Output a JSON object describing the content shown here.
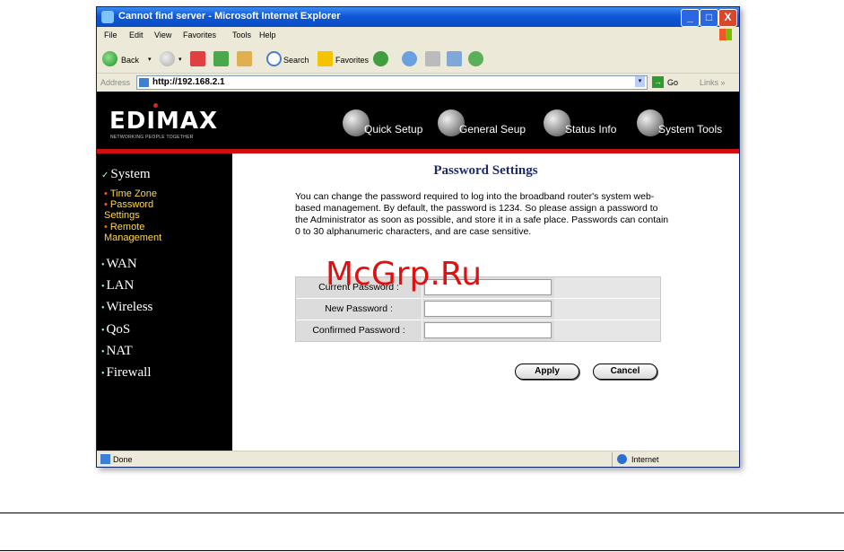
{
  "window": {
    "title": "Cannot find server - Microsoft Internet Explorer",
    "min_label": "_",
    "max_label": "□",
    "close_label": "X"
  },
  "menu": [
    "File",
    "Edit",
    "View",
    "Favorites",
    "Tools",
    "Help"
  ],
  "toolbar": {
    "back": "Back",
    "search": "Search",
    "favorites": "Favorites",
    "dropdown": "▾"
  },
  "address": {
    "label": "Address",
    "url": "http://192.168.2.1",
    "dropdown": "▾",
    "go_arrow": "→",
    "go": "Go",
    "links": "Links »"
  },
  "banner": {
    "logo": "EDIMAX",
    "tagline": "NETWORKING PEOPLE TOGETHER",
    "nav": [
      "Quick Setup",
      "General Seup",
      "Status Info",
      "System Tools"
    ]
  },
  "sidebar": {
    "system": "System",
    "system_mark": "✓",
    "sub": [
      "Time Zone",
      "Password Settings",
      "Remote Management"
    ],
    "sub_dot": "•",
    "bullet": "•",
    "items": [
      "WAN",
      "LAN",
      "Wireless",
      "QoS",
      "NAT",
      "Firewall"
    ]
  },
  "content": {
    "title": "Password Settings",
    "description": "You can change the password required to log into the broadband router's system web-based management. By default, the password is 1234. So please assign a password to the Administrator as soon as possible, and store it in a safe place. Passwords can contain 0 to 30 alphanumeric characters, and are case sensitive.",
    "fields": [
      {
        "label": "Current Password :",
        "value": ""
      },
      {
        "label": "New Password :",
        "value": ""
      },
      {
        "label": "Confirmed Password :",
        "value": ""
      }
    ],
    "apply": "Apply",
    "cancel": "Cancel"
  },
  "watermark": "McGrp.Ru",
  "status": {
    "text": "Done",
    "zone": "Internet"
  }
}
